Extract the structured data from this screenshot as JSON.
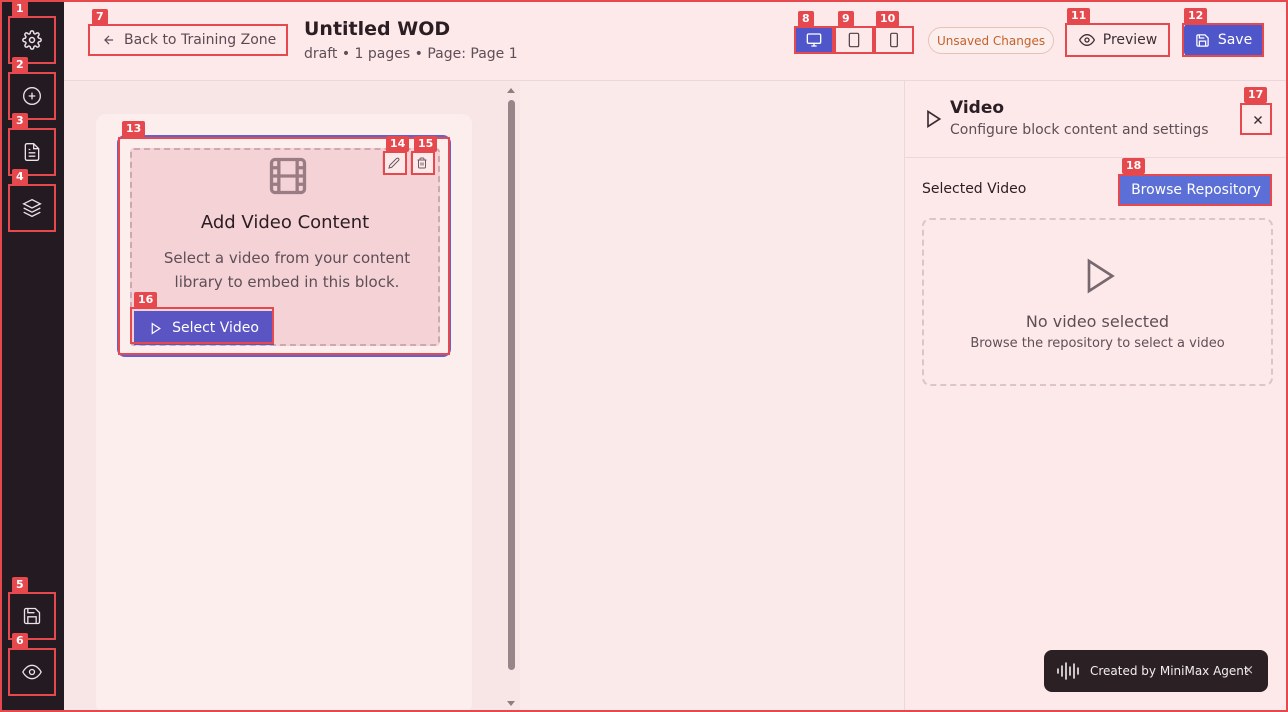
{
  "header": {
    "back_label": "Back to Training Zone",
    "title": "Untitled WOD",
    "subtitle": "draft • 1 pages • Page: Page 1",
    "unsaved_label": "Unsaved Changes",
    "preview_label": "Preview",
    "save_label": "Save"
  },
  "sidebar": {
    "items": [
      {
        "icon": "gear-icon"
      },
      {
        "icon": "plus-circle-icon"
      },
      {
        "icon": "document-icon"
      },
      {
        "icon": "layers-icon"
      },
      {
        "icon": "save-icon"
      },
      {
        "icon": "eye-icon"
      }
    ]
  },
  "device_toggle": {
    "options": [
      "desktop",
      "tablet",
      "mobile"
    ],
    "selected": "desktop"
  },
  "video_block": {
    "title": "Add Video Content",
    "description": "Select a video from your content library to embed in this block.",
    "select_label": "Select Video"
  },
  "panel": {
    "title": "Video",
    "subtitle": "Configure block content and settings",
    "selected_label": "Selected Video",
    "browse_label": "Browse Repository",
    "empty_title": "No video selected",
    "empty_sub": "Browse the repository to select a video"
  },
  "toast": {
    "label": "Created by MiniMax Agent",
    "close": "×"
  },
  "markers": [
    "1",
    "2",
    "3",
    "4",
    "5",
    "6",
    "7",
    "8",
    "9",
    "10",
    "11",
    "12",
    "13",
    "14",
    "15",
    "16",
    "17",
    "18"
  ],
  "colors": {
    "accent": "#4f56c9",
    "marker": "#e5484d",
    "sidebar_bg": "#231a22",
    "unsaved": "#c2612b"
  }
}
